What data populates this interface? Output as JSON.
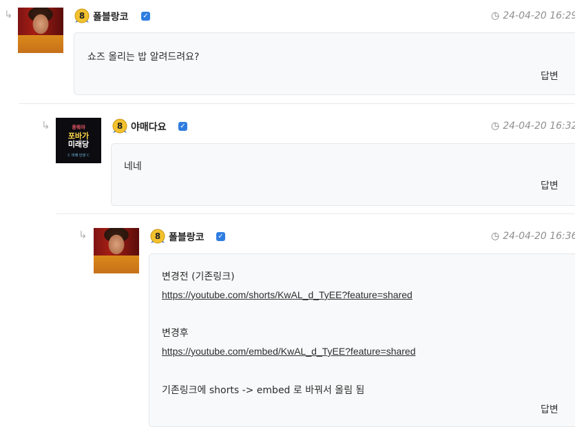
{
  "comments": [
    {
      "author": "폴블랑코",
      "level": "8",
      "timestamp": "24-04-20 16:29",
      "text": "쇼즈 올리는 밥 알려드려요?",
      "reply_label": "답변"
    },
    {
      "author": "야매다요",
      "level": "8",
      "timestamp": "24-04-20 16:32",
      "text": "네네",
      "reply_label": "답변",
      "avatar_text": {
        "line1": "종뭐야",
        "line2": "포바가",
        "line3": "미래당",
        "line4": "ㄷ 미래 인생 ㄷ"
      }
    },
    {
      "author": "폴블랑코",
      "level": "8",
      "timestamp": "24-04-20 16:36",
      "lines": {
        "before_label": "변경전 (기존링크)",
        "before_link": "https://youtube.com/shorts/KwAL_d_TyEE?feature=shared",
        "after_label": "변경후",
        "after_link": "https://youtube.com/embed/KwAL_d_TyEE?feature=shared",
        "note": "기존링크에 shorts -> embed 로 바꿔서 올림 됨"
      },
      "reply_label": "답변"
    }
  ],
  "icons": {
    "reply_arrow": "reply-arrow-icon",
    "clock": "clock-icon",
    "verified": "verified-check-icon",
    "level_badge": "level-badge-icon"
  },
  "colors": {
    "verified": "#2f7de1",
    "badge": "#f2c12e",
    "timestamp": "#8f8f8f",
    "bubble_bg": "#f8f9fa"
  }
}
